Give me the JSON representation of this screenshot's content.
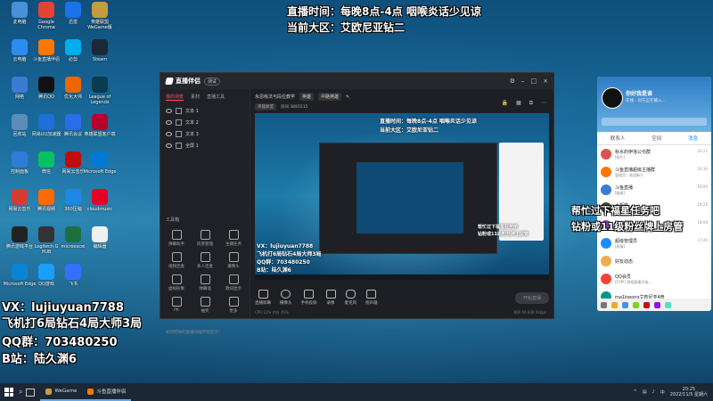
{
  "desktop_icons": [
    {
      "label": "此电脑",
      "color": "#4a90d9"
    },
    {
      "label": "Google Chrome",
      "color": "#e94235"
    },
    {
      "label": "迅雷",
      "color": "#1a73e8"
    },
    {
      "label": "英雄联盟WeGame版",
      "color": "#c89b3c"
    },
    {
      "label": "云电脑",
      "color": "#2d8cf0"
    },
    {
      "label": "斗鱼直播伴侣",
      "color": "#ff7700"
    },
    {
      "label": "必剪",
      "color": "#00aeec"
    },
    {
      "label": "Steam",
      "color": "#1b2838"
    },
    {
      "label": "网络",
      "color": "#3a7bd5"
    },
    {
      "label": "腾讯QQ",
      "color": "#111111"
    },
    {
      "label": "优化大师",
      "color": "#ee6600"
    },
    {
      "label": "League of Legends",
      "color": "#0a3b4f"
    },
    {
      "label": "回收站",
      "color": "#5b8db8"
    },
    {
      "label": "网易UU加速器",
      "color": "#1e6fd9"
    },
    {
      "label": "腾讯会议",
      "color": "#2b6de8"
    },
    {
      "label": "英雄联盟客户端",
      "color": "#b8002c"
    },
    {
      "label": "控制面板",
      "color": "#2f7cd6"
    },
    {
      "label": "微信",
      "color": "#07c160"
    },
    {
      "label": "网易云音乐",
      "color": "#c20c0c"
    },
    {
      "label": "Microsoft Edge",
      "color": "#0078d4"
    },
    {
      "label": "网易云音乐",
      "color": "#d43c33"
    },
    {
      "label": "腾讯视频",
      "color": "#ff6a00"
    },
    {
      "label": "360压缩",
      "color": "#1e88e5"
    },
    {
      "label": "cloudmusic",
      "color": "#e60026"
    },
    {
      "label": "腾讯游戏平台",
      "color": "#222222"
    },
    {
      "label": "Logitech G HUB",
      "color": "#333333"
    },
    {
      "label": "microexcel",
      "color": "#1d6f42"
    },
    {
      "label": "编辑器",
      "color": "#f0f0f0"
    },
    {
      "label": "Microsoft Edge",
      "color": "#0a84d6"
    },
    {
      "label": "QQ游戏",
      "color": "#1a9fff"
    },
    {
      "label": "飞书",
      "color": "#3370ff"
    }
  ],
  "overlay": {
    "top_line1": "直播时间：每晚8点-4点   咽喉炎话少见谅",
    "top_line2": "当前大区：艾欧尼亚钻二",
    "bottom_line1": "VX：lujiuyuan7788",
    "bottom_line2": "飞机打6局钻石4局大师3局",
    "bottom_line3": "QQ群：703480250",
    "bottom_line4": "B站：陆久渊6",
    "right_line1": "帮忙过下福星任务吧",
    "right_line2": "钻粉或11级粉丝牌上房管"
  },
  "live_window": {
    "app_name": "直播伴侣",
    "version": "测试",
    "left_tabs": [
      "我的场景",
      "素材",
      "直播工具"
    ],
    "scene_items": [
      "文本 1",
      "文本 2",
      "文本 3",
      "全屏 1"
    ],
    "tools_header": "工具箱",
    "tools": [
      "弹幕助手",
      "房管管理",
      "主播任务",
      "视频连麦",
      "多人连麦",
      "摄像头",
      "虚拟形象",
      "弹幕墙",
      "歌词显示",
      "PK",
      "抽奖",
      "更多"
    ],
    "help_text": "如何把你的直播间推荐到首页？",
    "room_title": "永恩练法与段位教学",
    "room_tag": "英雄",
    "room_category": "中路英雄",
    "room_sub": [
      "英雄联盟",
      "房间 3885515"
    ],
    "bottom_controls": [
      "直播屏幕",
      "摄像头",
      "手机投屏",
      "录像",
      "麦克风",
      "扬声器"
    ],
    "go_live": "开始直播",
    "status_left": "CPU 12%  内存 45%",
    "status_right": "帧率 60  码率 0kbps"
  },
  "qq_panel": {
    "user_name": "你好我是谁",
    "signature": "在线 - 对方正在输入...",
    "tabs": [
      "联系人",
      "空间",
      "消息"
    ],
    "items": [
      {
        "name": "秋水的伊洛公屯群",
        "msg": "[图片]",
        "time": "20:21",
        "color": "#d9534f"
      },
      {
        "name": "斗鱼直播超级主播群",
        "msg": "管理员：欢迎新人",
        "time": "19:30",
        "color": "#ff7700"
      },
      {
        "name": "斗鱼直播",
        "msg": "[链接]",
        "time": "19:00",
        "color": "#3a7bd5"
      },
      {
        "name": "水瓶座",
        "msg": "在吗",
        "time": "18:22",
        "color": "#444444"
      },
      {
        "name": "本小编号",
        "msg": "好的",
        "time": "18:00",
        "color": "#8e44ad"
      },
      {
        "name": "超级管理员",
        "msg": "[表情]",
        "time": "17:40",
        "color": "#1a8cff"
      },
      {
        "name": "好友动态",
        "msg": "",
        "time": "",
        "color": "#f0ad4e"
      },
      {
        "name": "QQ会员",
        "msg": "[CPPI] 游戏赛事开始...",
        "time": "",
        "color": "#f44336"
      },
      {
        "name": "ma1kwong艾欧尼亚4盘",
        "msg": "",
        "time": "",
        "color": "#009688"
      }
    ]
  },
  "taskbar": {
    "apps": [
      {
        "label": "WeGame",
        "color": "#c89b3c"
      },
      {
        "label": "斗鱼直播伴侣",
        "color": "#ff7700"
      }
    ],
    "time": "20:25",
    "date": "2022/11/5 星期六"
  }
}
